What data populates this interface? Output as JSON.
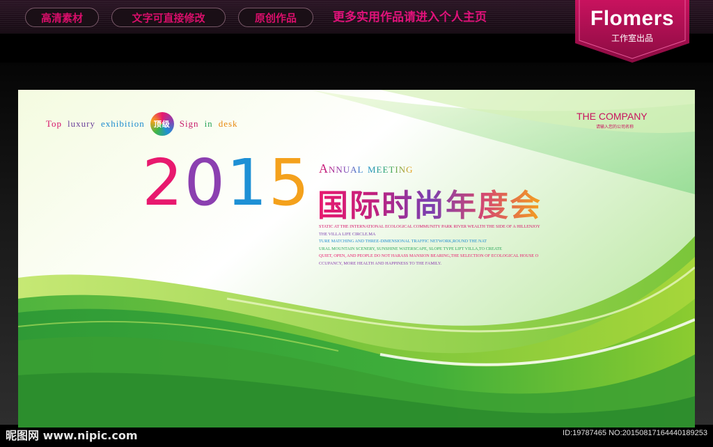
{
  "topbar": {
    "tags": [
      "高清素材",
      "文字可直接修改",
      "原创作品"
    ],
    "link": "更多实用作品请进入个人主页",
    "brand_name": "Flomers",
    "brand_sub": "工作室出品"
  },
  "banner": {
    "tagline": {
      "w1": "Top",
      "w2": "luxury",
      "w3": "exhibition",
      "badge": "顶级",
      "w4": "Sign",
      "w5": "in",
      "w6": "desk"
    },
    "company": "THE COMPANY",
    "company_sub": "请输入您的公司名称",
    "year_digits": [
      "2",
      "0",
      "1",
      "5"
    ],
    "annual": "Annual meeting",
    "title_cn": "国际时尚年度会",
    "body_lines": [
      "STATIC AT THE INTERNATIONAL ECOLOGICAL COMMUNITY PARK RIVER WEALTH THE SIDE OF A HILLENJOY",
      "THE VILLA LIFE CIRCLE.MA",
      "TURE MATCHING AND THREE-DIMENSIONAL TRAFFIC NETWORK,ROUND THE NAT",
      "URAL MOUNTAIN SCENERY, SUNSHINE WATERSCAPE, SLOPE TYPE LIFT VILLA,TO CREATE",
      "QUIET, OPEN, AND PEOPLE DO NOT HARASS MANSION BEARING,THE SELECTION OF ECOLOGICAL HOUSE O",
      "CCUPANCY, MORE HEALTH AND HAPPINESS TO THE FAMILY."
    ],
    "colors": {
      "green_dark": "#2e9a2e",
      "green_light": "#9fd23a",
      "magenta": "#e8196e",
      "purple": "#8b3fb0",
      "blue": "#1e90d5",
      "orange": "#f4a11c"
    }
  },
  "watermark": {
    "logo": "昵图网 www.nipic.com",
    "id": "ID:19787465 NO:20150817164440189253"
  }
}
